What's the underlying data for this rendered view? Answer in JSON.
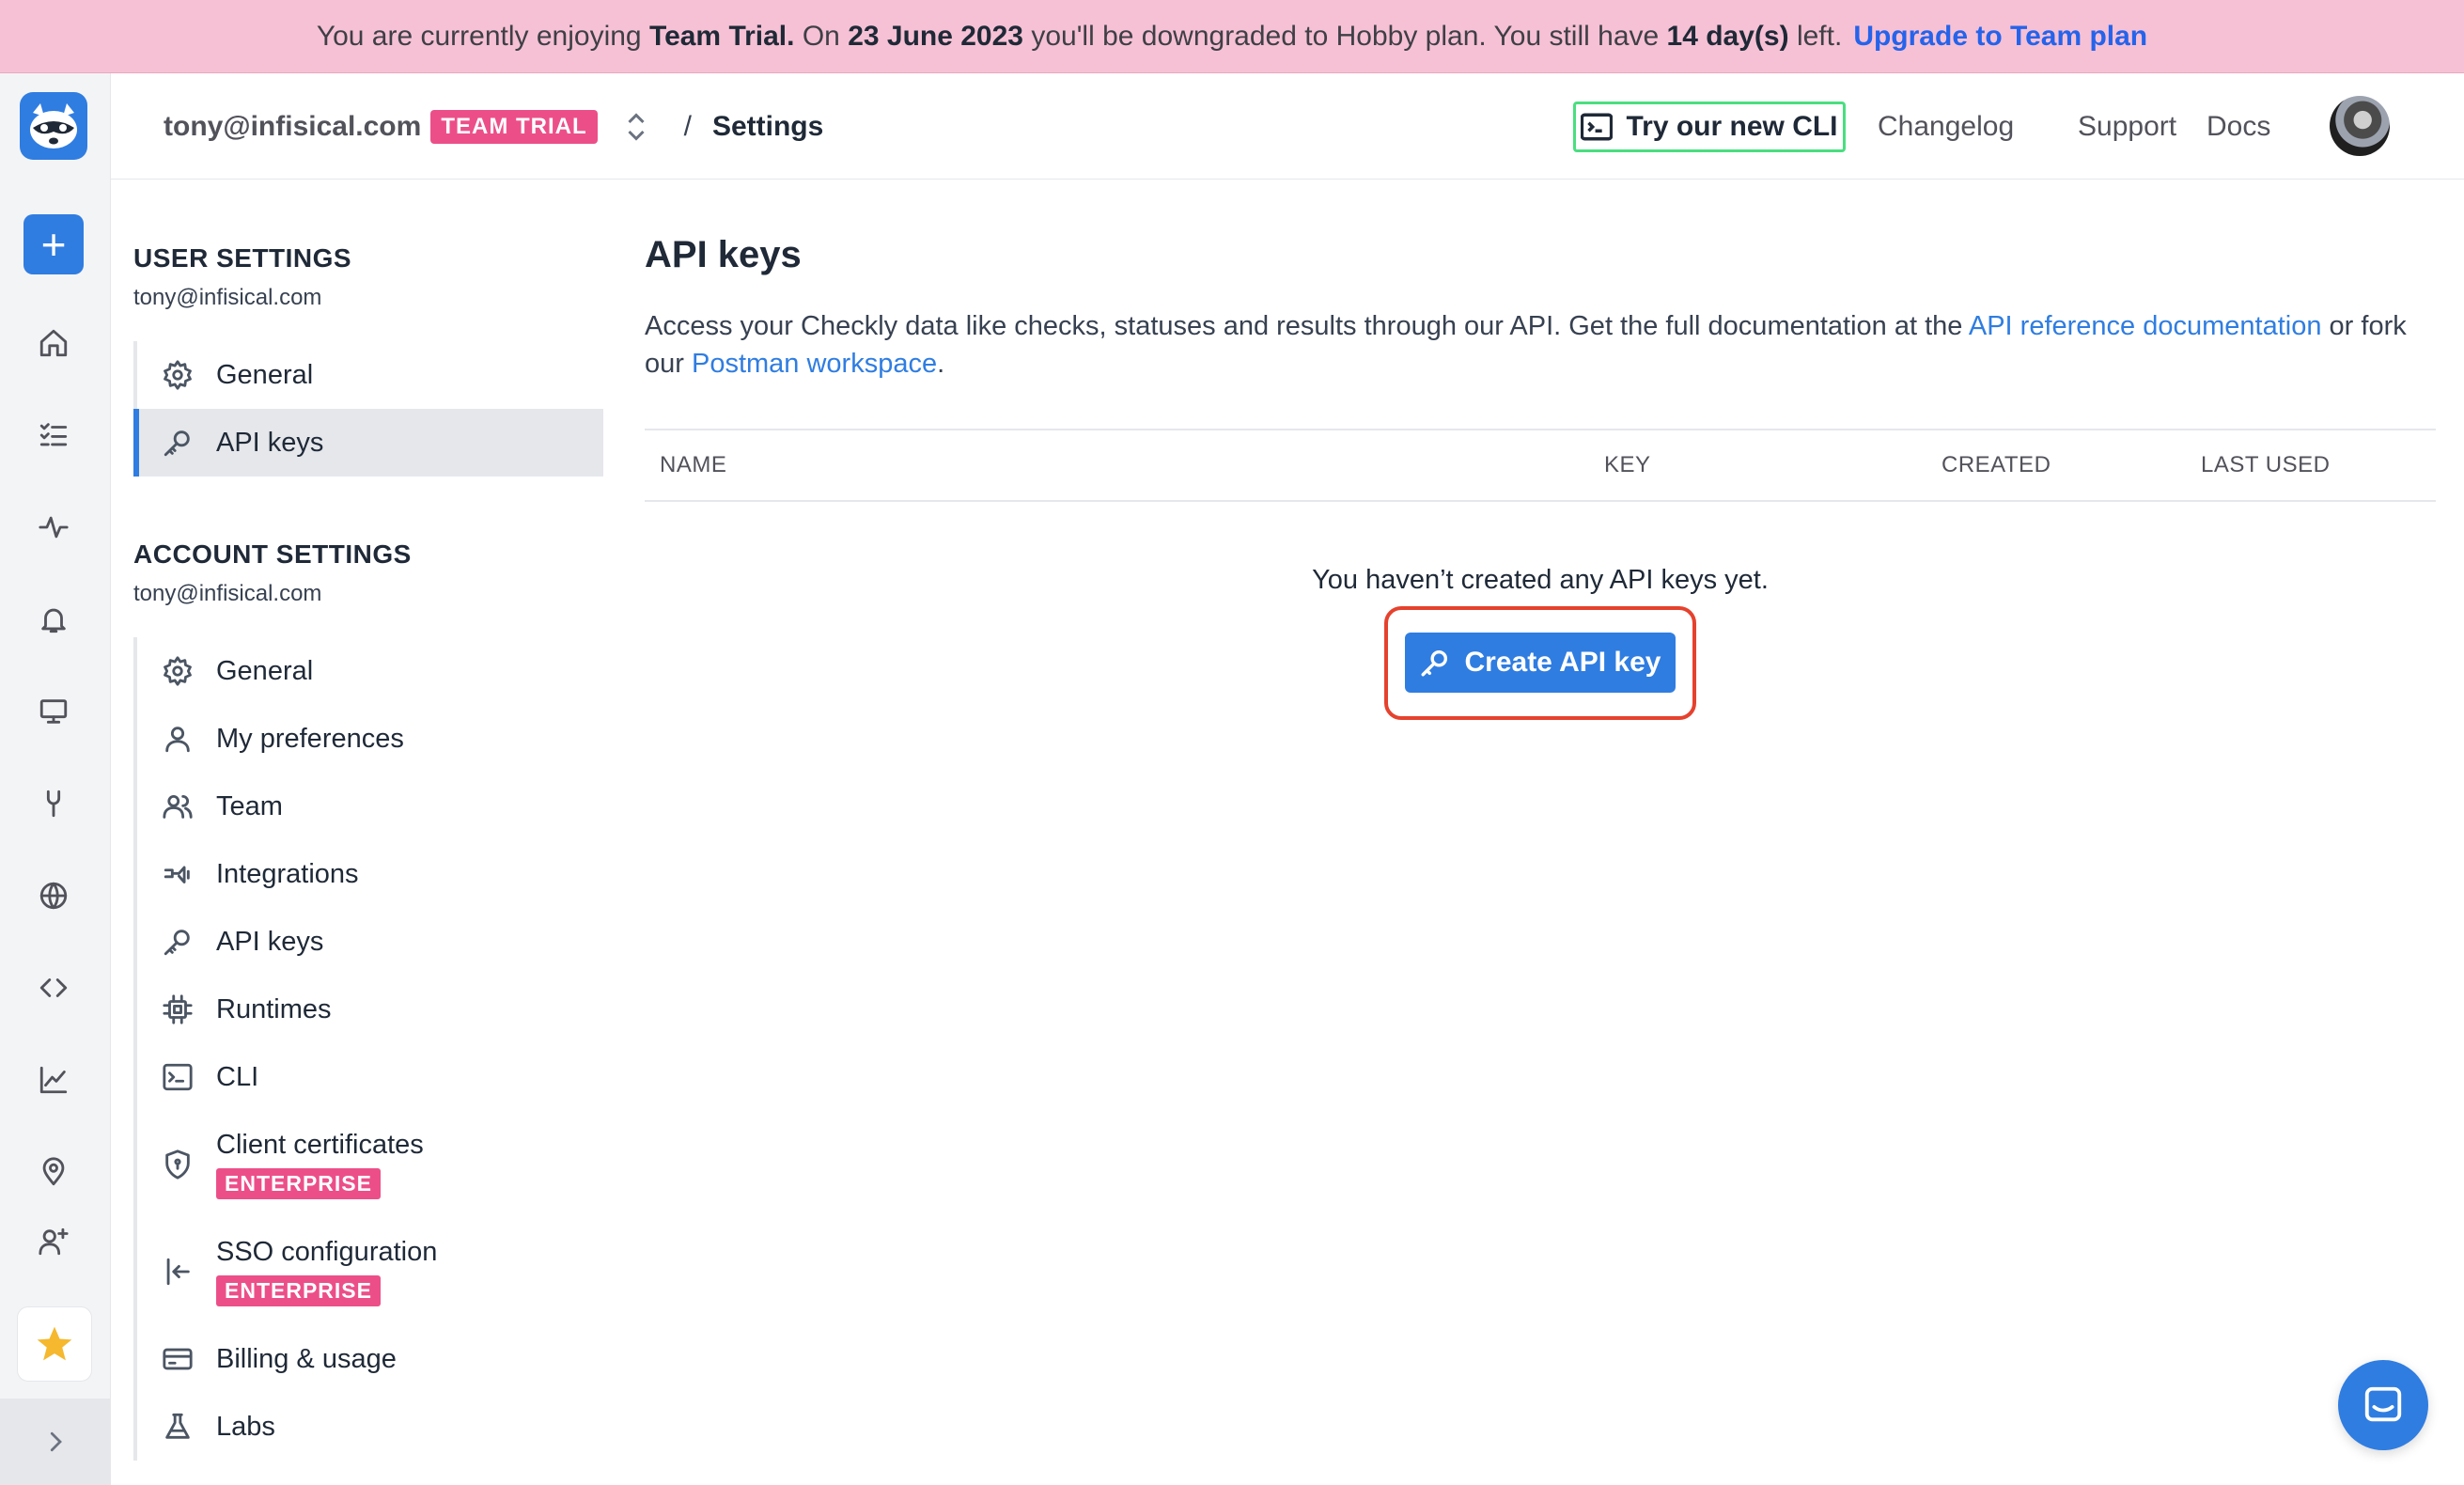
{
  "banner": {
    "t1": "You are currently enjoying ",
    "plan": "Team Trial.",
    "t2": " On ",
    "date": "23 June 2023",
    "t3": " you'll be downgraded to Hobby plan. You still have ",
    "days": "14 day(s)",
    "t4": " left.",
    "upgrade": "Upgrade to Team plan"
  },
  "header": {
    "account": "tony@infisical.com",
    "badge": "TEAM TRIAL",
    "separator": "/",
    "title": "Settings",
    "cli": "Try our new CLI",
    "changelog": "Changelog",
    "support": "Support",
    "docs": "Docs"
  },
  "rail": {
    "icons": [
      "home-icon",
      "checks-list-icon",
      "activity-icon",
      "bell-icon",
      "monitor-icon",
      "tools-icon",
      "globe-icon",
      "code-icon",
      "chart-icon",
      "location-icon",
      "add-user-icon"
    ],
    "star_color": "#f5b82e",
    "accent": "#2f7de1"
  },
  "sidebar": {
    "user_title": "USER SETTINGS",
    "user_email": "tony@infisical.com",
    "user_items": [
      {
        "label": "General",
        "icon": "gear-icon"
      },
      {
        "label": "API keys",
        "icon": "key-icon",
        "active": true
      }
    ],
    "account_title": "ACCOUNT SETTINGS",
    "account_email": "tony@infisical.com",
    "account_items": [
      {
        "label": "General",
        "icon": "gear-icon"
      },
      {
        "label": "My preferences",
        "icon": "user-icon"
      },
      {
        "label": "Team",
        "icon": "team-icon"
      },
      {
        "label": "Integrations",
        "icon": "plug-icon"
      },
      {
        "label": "API keys",
        "icon": "key-icon"
      },
      {
        "label": "Runtimes",
        "icon": "cpu-icon"
      },
      {
        "label": "CLI",
        "icon": "terminal-icon"
      },
      {
        "label": "Client certificates",
        "icon": "shield-icon",
        "badge": "ENTERPRISE"
      },
      {
        "label": "SSO configuration",
        "icon": "login-icon",
        "badge": "ENTERPRISE"
      },
      {
        "label": "Billing & usage",
        "icon": "credit-card-icon"
      },
      {
        "label": "Labs",
        "icon": "flask-icon"
      }
    ]
  },
  "main": {
    "title": "API keys",
    "desc1": "Access your Checkly data like checks, statuses and results through our API. Get the full documentation at the ",
    "link1": "API reference documentation",
    "desc2": " or fork our ",
    "link2": "Postman workspace",
    "desc3": ".",
    "columns": [
      "NAME",
      "KEY",
      "CREATED",
      "LAST USED"
    ],
    "empty": "You haven’t created any API keys yet.",
    "create": "Create API key"
  },
  "colors": {
    "banner_bg": "#f6c1d4",
    "brand_blue": "#2f7de1",
    "badge_pink": "#ec4f88",
    "highlight_red": "#e5422e",
    "cli_border": "#4ade80"
  }
}
